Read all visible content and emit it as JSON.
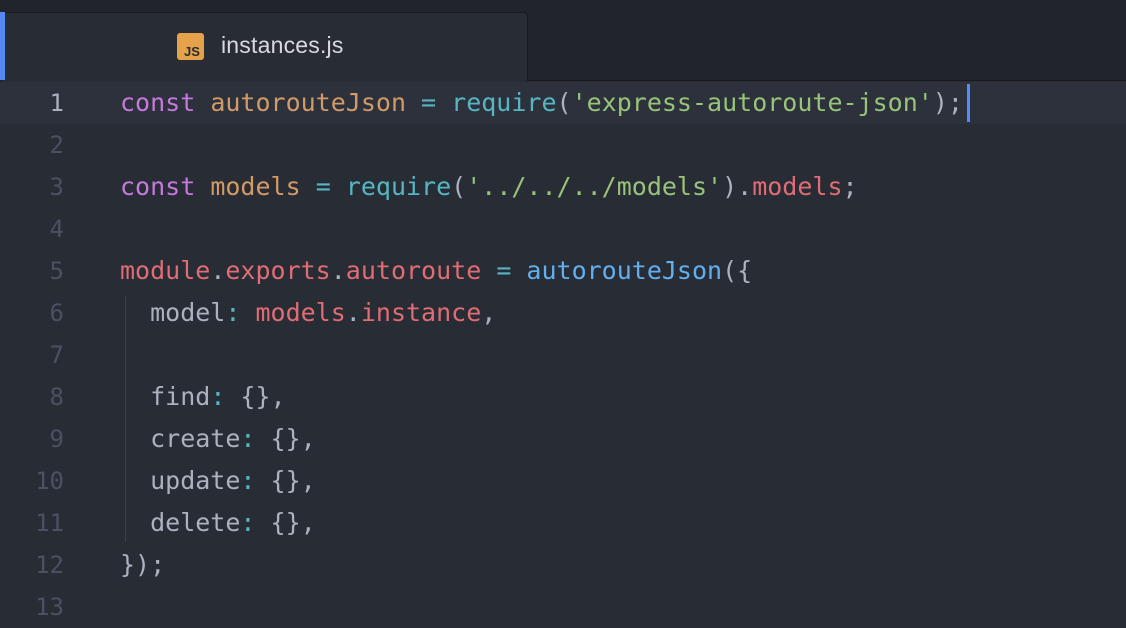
{
  "tab": {
    "icon_label": "JS",
    "title": "instances.js"
  },
  "editor": {
    "lines": [
      {
        "number": "1",
        "tokens": [
          {
            "t": "const",
            "c": "kw"
          },
          {
            "t": " ",
            "c": "punc"
          },
          {
            "t": "autorouteJson",
            "c": "def"
          },
          {
            "t": " = ",
            "c": "fn"
          },
          {
            "t": "require",
            "c": "fn"
          },
          {
            "t": "(",
            "c": "punc"
          },
          {
            "t": "'express-autoroute-json'",
            "c": "str"
          },
          {
            "t": ");",
            "c": "punc"
          }
        ]
      },
      {
        "number": "2",
        "tokens": []
      },
      {
        "number": "3",
        "tokens": [
          {
            "t": "const",
            "c": "kw"
          },
          {
            "t": " ",
            "c": "punc"
          },
          {
            "t": "models",
            "c": "def"
          },
          {
            "t": " = ",
            "c": "fn"
          },
          {
            "t": "require",
            "c": "fn"
          },
          {
            "t": "(",
            "c": "punc"
          },
          {
            "t": "'../../../models'",
            "c": "str"
          },
          {
            "t": ").",
            "c": "punc"
          },
          {
            "t": "models",
            "c": "prop"
          },
          {
            "t": ";",
            "c": "punc"
          }
        ]
      },
      {
        "number": "4",
        "tokens": []
      },
      {
        "number": "5",
        "tokens": [
          {
            "t": "module",
            "c": "prop"
          },
          {
            "t": ".",
            "c": "punc"
          },
          {
            "t": "exports",
            "c": "prop"
          },
          {
            "t": ".",
            "c": "punc"
          },
          {
            "t": "autoroute",
            "c": "prop"
          },
          {
            "t": " = ",
            "c": "fn"
          },
          {
            "t": "autorouteJson",
            "c": "call"
          },
          {
            "t": "({",
            "c": "punc"
          }
        ]
      },
      {
        "number": "6",
        "tokens": [
          {
            "t": "  model",
            "c": "punc"
          },
          {
            "t": ": ",
            "c": "fn"
          },
          {
            "t": "models",
            "c": "prop"
          },
          {
            "t": ".",
            "c": "punc"
          },
          {
            "t": "instance",
            "c": "prop"
          },
          {
            "t": ",",
            "c": "punc"
          }
        ]
      },
      {
        "number": "7",
        "tokens": []
      },
      {
        "number": "8",
        "tokens": [
          {
            "t": "  find",
            "c": "punc"
          },
          {
            "t": ": ",
            "c": "fn"
          },
          {
            "t": "{},",
            "c": "punc"
          }
        ]
      },
      {
        "number": "9",
        "tokens": [
          {
            "t": "  create",
            "c": "punc"
          },
          {
            "t": ": ",
            "c": "fn"
          },
          {
            "t": "{},",
            "c": "punc"
          }
        ]
      },
      {
        "number": "10",
        "tokens": [
          {
            "t": "  update",
            "c": "punc"
          },
          {
            "t": ": ",
            "c": "fn"
          },
          {
            "t": "{},",
            "c": "punc"
          }
        ]
      },
      {
        "number": "11",
        "tokens": [
          {
            "t": "  delete",
            "c": "punc"
          },
          {
            "t": ": ",
            "c": "fn"
          },
          {
            "t": "{},",
            "c": "punc"
          }
        ]
      },
      {
        "number": "12",
        "tokens": [
          {
            "t": "});",
            "c": "punc"
          }
        ]
      },
      {
        "number": "13",
        "tokens": []
      }
    ]
  },
  "colors": {
    "background": "#282c34",
    "tab_accent": "#568af2",
    "js_icon": "#e5a24b",
    "keyword": "#c678dd",
    "string": "#98c379",
    "property": "#e06c75",
    "function": "#61afef"
  }
}
